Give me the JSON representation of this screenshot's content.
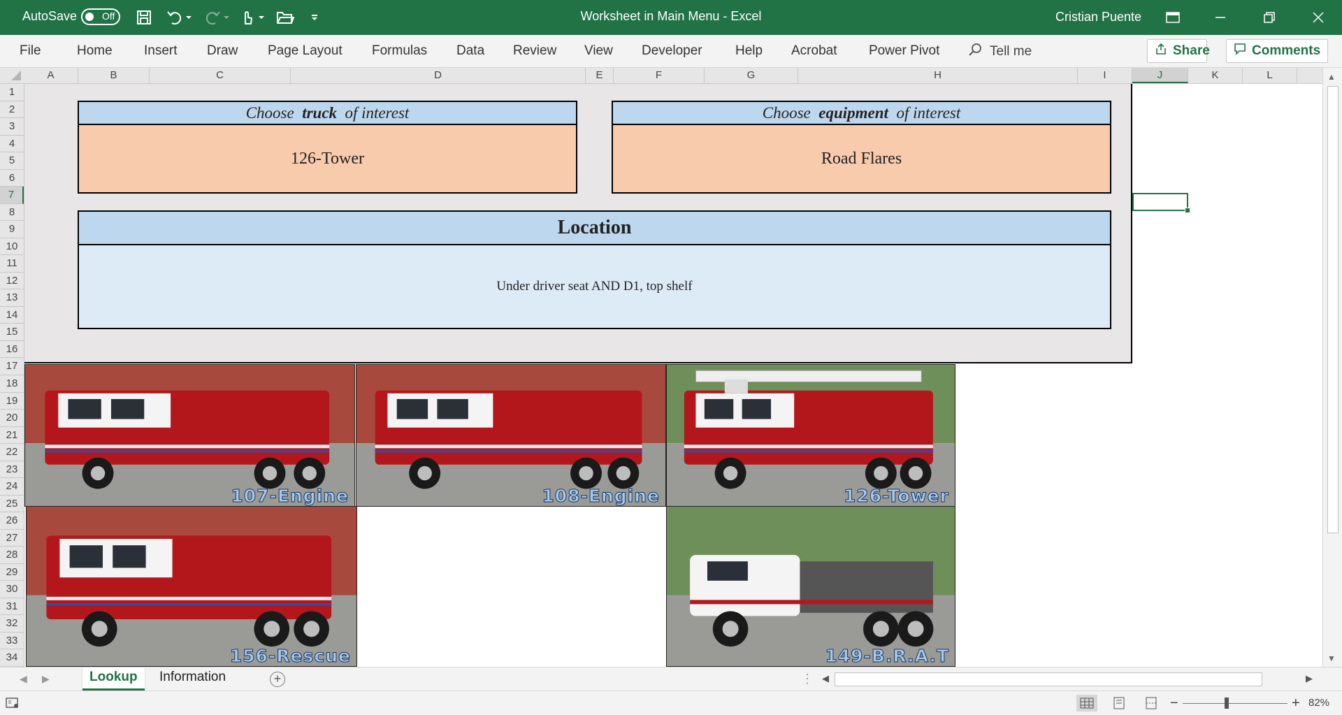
{
  "titlebar": {
    "autosave_label": "AutoSave",
    "autosave_state": "Off",
    "doc_title": "Worksheet in Main Menu  -  Excel",
    "user": "Cristian Puente"
  },
  "ribbon": {
    "tabs": [
      "File",
      "Home",
      "Insert",
      "Draw",
      "Page Layout",
      "Formulas",
      "Data",
      "Review",
      "View",
      "Developer",
      "Help",
      "Acrobat",
      "Power Pivot"
    ],
    "tell_me": "Tell me",
    "share": "Share",
    "comments": "Comments"
  },
  "grid": {
    "columns": [
      "A",
      "B",
      "C",
      "D",
      "E",
      "F",
      "G",
      "H",
      "I",
      "J",
      "K",
      "L"
    ],
    "selected_column": "J",
    "rows": [
      "1",
      "2",
      "3",
      "4",
      "5",
      "6",
      "7",
      "8",
      "9",
      "10",
      "11",
      "12",
      "13",
      "14",
      "15",
      "16",
      "17",
      "18",
      "19",
      "20",
      "21",
      "22",
      "23",
      "24",
      "25",
      "26",
      "27",
      "28",
      "29",
      "30",
      "31",
      "32",
      "33",
      "34"
    ],
    "selected_row": "7"
  },
  "lookup": {
    "truck_header": {
      "pre": "Choose",
      "key": "truck",
      "post": "of interest"
    },
    "truck_value": "126-Tower",
    "equipment_header": {
      "pre": "Choose",
      "key": "equipment",
      "post": "of interest"
    },
    "equipment_value": "Road Flares",
    "location_header": "Location",
    "location_value": "Under driver seat AND D1, top shelf"
  },
  "photos": [
    {
      "label": "107-Engine"
    },
    {
      "label": "108-Engine"
    },
    {
      "label": "126-Tower"
    },
    {
      "label": "156-Rescue"
    },
    {
      "label": "149-B.R.A.T"
    }
  ],
  "sheets": [
    "Lookup",
    "Information"
  ],
  "active_sheet": "Lookup",
  "status": {
    "zoom": "82%"
  },
  "colors": {
    "excel_green": "#217346",
    "header_blue": "#bdd7ee",
    "value_peach": "#f8cbad",
    "location_blue": "#ddebf7",
    "truck_red": "#b3171c"
  }
}
